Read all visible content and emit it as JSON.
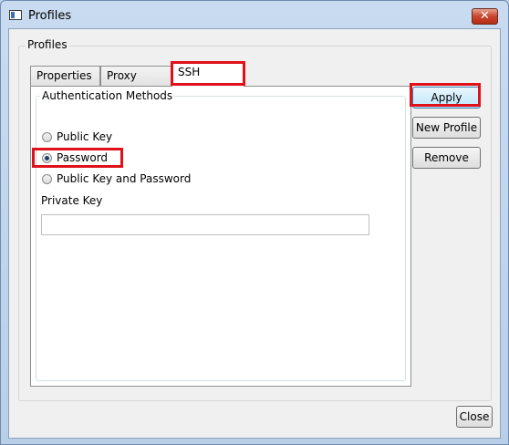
{
  "window": {
    "title": "Profiles",
    "close_glyph": "✕"
  },
  "group": {
    "label": "Profiles"
  },
  "tabs": [
    {
      "label": "Properties",
      "active": false
    },
    {
      "label": "Proxy",
      "active": false
    },
    {
      "label": "SSH",
      "active": true
    }
  ],
  "ssh": {
    "auth_group_label": "Authentication Methods",
    "options": [
      {
        "label": "Public Key",
        "checked": false
      },
      {
        "label": "Password",
        "checked": true
      },
      {
        "label": "Public Key and Password",
        "checked": false
      }
    ],
    "private_key_label": "Private Key",
    "private_key_value": ""
  },
  "buttons": {
    "apply": "Apply",
    "new_profile": "New Profile",
    "remove": "Remove",
    "close": "Close"
  },
  "colors": {
    "highlight": "#e0111b",
    "accent": "#3c7fb1"
  }
}
